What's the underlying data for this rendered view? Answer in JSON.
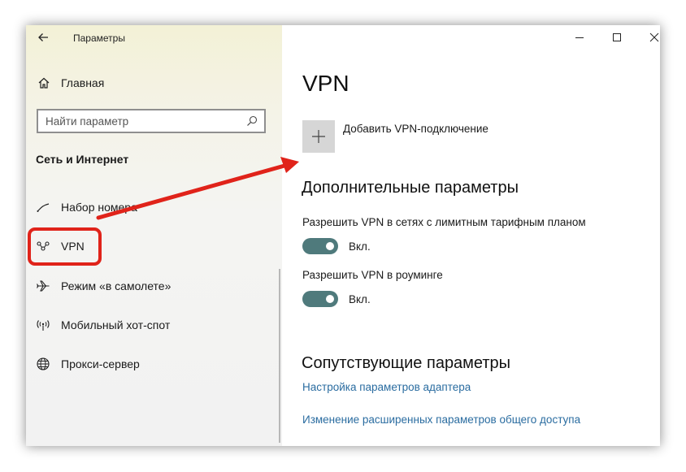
{
  "window": {
    "title": "Параметры",
    "controls": [
      "minimize-icon",
      "maximize-icon",
      "close-icon"
    ]
  },
  "sidebar": {
    "home_label": "Главная",
    "search_placeholder": "Найти параметр",
    "section_title": "Сеть и Интернет",
    "items": [
      {
        "label": "Набор номера",
        "icon": "dialup-icon"
      },
      {
        "label": "VPN",
        "icon": "vpn-icon",
        "highlighted": true
      },
      {
        "label": "Режим «в самолете»",
        "icon": "airplane-icon"
      },
      {
        "label": "Мобильный хот-спот",
        "icon": "hotspot-icon"
      },
      {
        "label": "Прокси-сервер",
        "icon": "globe-icon"
      }
    ]
  },
  "main": {
    "title": "VPN",
    "add_vpn_label": "Добавить VPN-подключение",
    "advanced_heading": "Дополнительные параметры",
    "options": [
      {
        "label": "Разрешить VPN в сетях с лимитным тарифным планом",
        "state": "Вкл.",
        "on": true
      },
      {
        "label": "Разрешить VPN в роуминге",
        "state": "Вкл.",
        "on": true
      }
    ],
    "related_heading": "Сопутствующие параметры",
    "links": [
      "Настройка параметров адаптера",
      "Изменение расширенных параметров общего доступа"
    ]
  },
  "colors": {
    "highlight": "#e0231a",
    "toggle_on": "#4f7a7c",
    "link": "#2a6ca0"
  }
}
